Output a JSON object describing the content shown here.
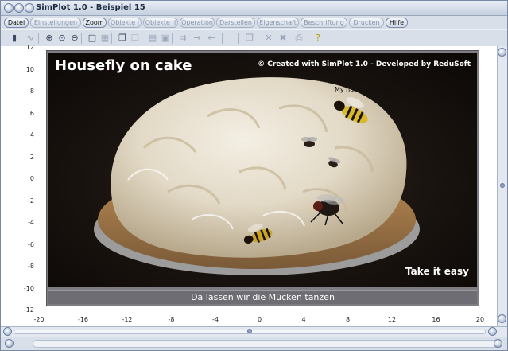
{
  "window": {
    "title": "SimPlot 1.0 - Beispiel 15"
  },
  "menu": [
    {
      "label": "Datei",
      "enabled": true
    },
    {
      "label": "Einstellungen",
      "enabled": false
    },
    {
      "label": "Zoom",
      "enabled": true
    },
    {
      "label": "Objekte I",
      "enabled": false
    },
    {
      "label": "Objekte II",
      "enabled": false
    },
    {
      "label": "Operation",
      "enabled": false
    },
    {
      "label": "Darstellen",
      "enabled": false
    },
    {
      "label": "Eigenschaft",
      "enabled": false
    },
    {
      "label": "Beschriftung",
      "enabled": false
    },
    {
      "label": "Drucken",
      "enabled": false
    },
    {
      "label": "Hilfe",
      "enabled": true
    }
  ],
  "toolbar": [
    {
      "icon": "calculator-icon",
      "glyph": "▮"
    },
    {
      "icon": "graph-icon",
      "glyph": "∿"
    },
    {
      "icon": "zoom-in-icon",
      "glyph": "⊕"
    },
    {
      "icon": "zoom-fit-icon",
      "glyph": "⊙"
    },
    {
      "icon": "zoom-out-icon",
      "glyph": "⊖"
    },
    {
      "icon": "frame-icon",
      "glyph": "□"
    },
    {
      "icon": "grid-icon",
      "glyph": "▦"
    },
    {
      "icon": "copy-icon",
      "glyph": "❐"
    },
    {
      "icon": "paste-icon",
      "glyph": "❏"
    },
    {
      "icon": "table-icon",
      "glyph": "▤"
    },
    {
      "icon": "image-icon",
      "glyph": "▣"
    },
    {
      "icon": "export-icon",
      "glyph": "⇉"
    },
    {
      "icon": "arrow-right-icon",
      "glyph": "→"
    },
    {
      "icon": "arrow-left-icon",
      "glyph": "←"
    },
    {
      "icon": "pages-icon",
      "glyph": "❒"
    },
    {
      "icon": "delete-icon",
      "glyph": "✕"
    },
    {
      "icon": "delete-all-icon",
      "glyph": "✖"
    },
    {
      "icon": "print-icon",
      "glyph": "⎙"
    },
    {
      "icon": "help-icon",
      "glyph": "?"
    }
  ],
  "axes": {
    "y_ticks": [
      "12",
      "10",
      "8",
      "6",
      "4",
      "2",
      "0",
      "-2",
      "-4",
      "-6",
      "-8",
      "-10",
      "-12"
    ],
    "x_ticks": [
      "-20",
      "-16",
      "-12",
      "-8",
      "-4",
      "0",
      "4",
      "8",
      "12",
      "16",
      "20"
    ]
  },
  "photo": {
    "title": "Housefly on cake",
    "credit": "© Created with SimPlot 1.0 - Developed by ReduSoft",
    "note": "My name is Maja",
    "slogan": "Take it easy",
    "caption": "Da lassen wir die Mücken tanzen"
  },
  "colors": {
    "accent": "#8ea3c6",
    "photo_frame": "#7d7d82"
  }
}
